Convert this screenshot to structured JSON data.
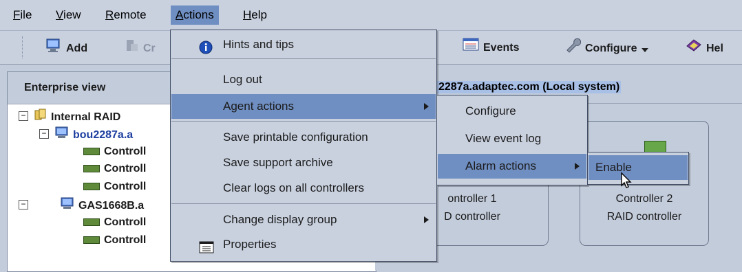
{
  "menubar": {
    "items": [
      {
        "label": "File",
        "mnemonic": "F",
        "rest": "ile"
      },
      {
        "label": "View",
        "mnemonic": "V",
        "rest": "iew"
      },
      {
        "label": "Remote",
        "mnemonic": "R",
        "rest": "emote"
      },
      {
        "label": "Actions",
        "mnemonic": "A",
        "rest": "ctions"
      },
      {
        "label": "Help",
        "mnemonic": "H",
        "rest": "elp"
      }
    ]
  },
  "toolbar": {
    "add_label": "Add",
    "create_label": "Cr",
    "events_label": "Events",
    "configure_label": "Configure",
    "help_label": "Hel"
  },
  "enterprise": {
    "header": "Enterprise view",
    "tree": [
      {
        "label": "Internal RAID"
      },
      {
        "label": "bou2287a.a"
      },
      {
        "label": "Controll"
      },
      {
        "label": "Controll"
      },
      {
        "label": "Controll"
      },
      {
        "label": "GAS1668B.a"
      },
      {
        "label": "Controll"
      },
      {
        "label": "Controll"
      }
    ]
  },
  "right_panel": {
    "header": "2287a.adaptec.com (Local system)",
    "card1": {
      "line1": "ontroller 1",
      "line2": "D controller"
    },
    "card2": {
      "line1": "Controller 2",
      "line2": "RAID controller"
    }
  },
  "actions_menu": {
    "items": [
      "Hints and tips",
      "Log out",
      "Agent actions",
      "Save printable configuration",
      "Save support archive",
      "Clear logs on all controllers",
      "Change display group",
      "Properties"
    ]
  },
  "agent_menu": {
    "items": [
      "Configure",
      "View event log",
      "Alarm actions"
    ]
  },
  "alarm_menu": {
    "items": [
      "Enable"
    ]
  },
  "colors": {
    "menu_highlight": "#6f8ec1",
    "background": "#c3ccdb",
    "link_blue": "#1d3ea0"
  }
}
